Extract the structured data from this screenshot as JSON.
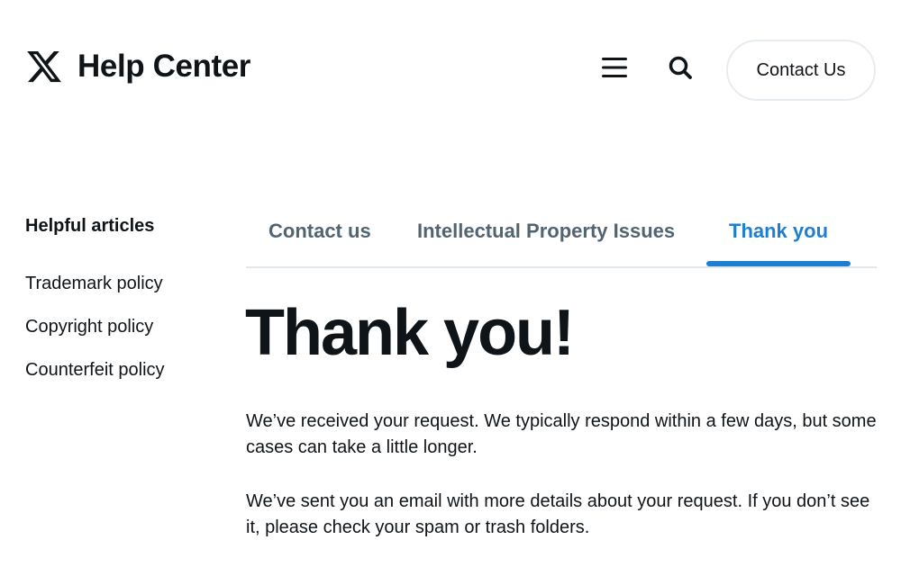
{
  "header": {
    "brand_title": "Help Center",
    "contact_label": "Contact Us",
    "logo_icon": "x-logo-icon",
    "menu_icon": "hamburger-menu-icon",
    "search_icon": "search-icon"
  },
  "sidebar": {
    "heading": "Helpful articles",
    "items": [
      {
        "label": "Trademark policy"
      },
      {
        "label": "Copyright policy"
      },
      {
        "label": "Counterfeit policy"
      }
    ]
  },
  "tabs": [
    {
      "label": "Contact us",
      "active": false
    },
    {
      "label": "Intellectual Property Issues",
      "active": false
    },
    {
      "label": "Thank you",
      "active": true
    }
  ],
  "main": {
    "headline": "Thank you!",
    "paragraphs": [
      "We’ve received your request. We typically respond within a few days, but some cases can take a little longer.",
      "We’ve sent you an email with more details about your request. If you don’t see it, please check your spam or trash folders."
    ]
  },
  "colors": {
    "accent": "#1d7fd1",
    "text": "#0f1419",
    "muted": "#536471",
    "border": "#e1e8ed"
  }
}
